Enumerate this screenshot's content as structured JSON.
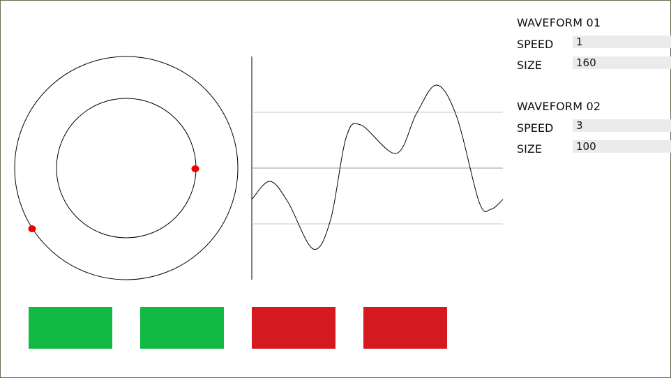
{
  "waveforms": [
    {
      "title": "WAVEFORM 01",
      "speed_label": "SPEED",
      "speed": "1",
      "size_label": "SIZE",
      "size": "160"
    },
    {
      "title": "WAVEFORM 02",
      "speed_label": "SPEED",
      "speed": "3",
      "size_label": "SIZE",
      "size": "100"
    }
  ],
  "buttons": [
    {
      "name": "green-button-1",
      "color": "#10b942"
    },
    {
      "name": "green-button-2",
      "color": "#10b942"
    },
    {
      "name": "red-button-1",
      "color": "#d51920"
    },
    {
      "name": "red-button-2",
      "color": "#d51920"
    }
  ],
  "colors": {
    "dot": "#ee0000",
    "grid": "#c8c8c8",
    "axis": "#000000"
  }
}
